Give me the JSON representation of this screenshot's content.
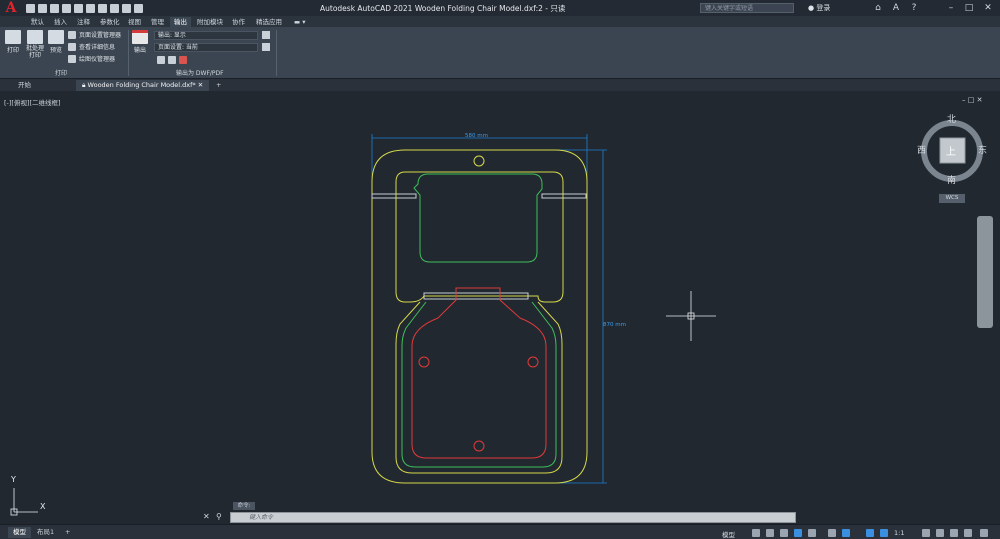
{
  "titlebar": {
    "app_title": "Autodesk AutoCAD 2021    Wooden Folding Chair Model.dxf:2 - 只读",
    "search_placeholder": "键入关键字或短语",
    "login_label": "登录"
  },
  "menu": {
    "tabs": [
      "默认",
      "插入",
      "注释",
      "参数化",
      "视图",
      "管理",
      "输出",
      "附加模块",
      "协作",
      "精选应用"
    ],
    "active": "输出"
  },
  "ribbon": {
    "print_label": "打印",
    "batch_print_label": "批处理\n打印",
    "preview_label": "预览",
    "page_setup_manager": "页面设置管理器",
    "view_details": "查看详细信息",
    "plotter_manager": "绘图仪管理器",
    "print_panel_label": "打印",
    "export_label": "输出",
    "export_display": "输出: 显示",
    "page_setup_current": "页面设置: 当前",
    "export_panel_label": "输出为 DWF/PDF"
  },
  "filetabs": {
    "start_tab": "开始",
    "drawing_tab": "Wooden Folding Chair Model.dxf*"
  },
  "viewport": {
    "view_label": "[-][俯视][二维线框]",
    "dim_width": "580 mm",
    "dim_height": "870 mm",
    "axis_x": "X",
    "axis_y": "Y"
  },
  "viewcube": {
    "north": "北",
    "south": "南",
    "east": "东",
    "west": "西",
    "top": "上",
    "wcs": "WCS"
  },
  "command": {
    "placeholder": "键入命令",
    "history_label": "命令:"
  },
  "statusbar": {
    "model_tab": "模型",
    "layout_tab": "布局1",
    "model_label": "模型",
    "scale_label": "1:1"
  },
  "colors": {
    "outline": "#d6d94a",
    "inner": "#3fbf5a",
    "seat": "#e03a3a",
    "dimension": "#1f7fd1"
  }
}
